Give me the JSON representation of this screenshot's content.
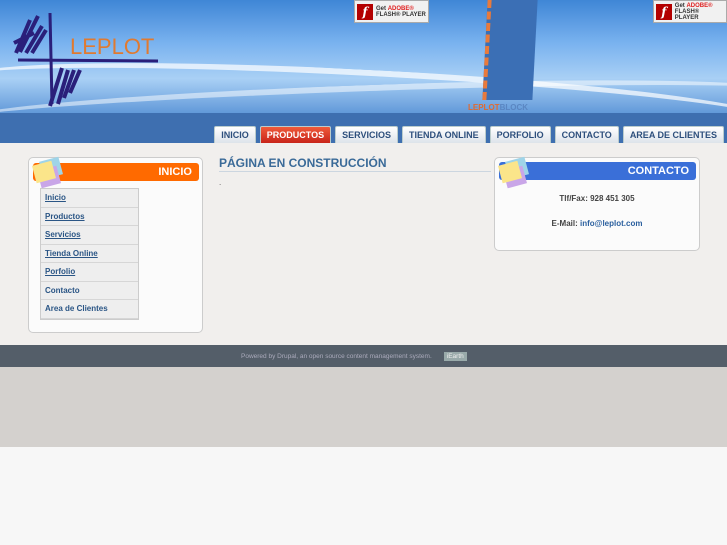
{
  "header": {
    "logo_text": "LEPLOT",
    "flash_badge": {
      "get": "Get",
      "adobe": "ADOBE®",
      "product": "FLASH® PLAYER"
    },
    "block_brand": [
      "LEPLOT",
      "BLOCK"
    ]
  },
  "nav": {
    "tabs": [
      {
        "label": "INICIO"
      },
      {
        "label": "PRODUCTOS",
        "active": true
      },
      {
        "label": "SERVICIOS"
      },
      {
        "label": "TIENDA ONLINE"
      },
      {
        "label": "PORFOLIO"
      },
      {
        "label": "CONTACTO"
      },
      {
        "label": "AREA DE CLIENTES"
      }
    ]
  },
  "sidebar": {
    "title": "INICIO",
    "items": [
      "Inicio",
      "Productos",
      "Servicios",
      "Tienda Online",
      "Porfolio",
      "Contacto",
      "Area de Clientes"
    ]
  },
  "main": {
    "title": "PÁGINA EN CONSTRUCCIÓN",
    "body": "."
  },
  "contact": {
    "title": "CONTACTO",
    "phone": "Tlf/Fax: 928 451 305",
    "email_label": "E-Mail:",
    "email": "info@leplot.com"
  },
  "footer": {
    "text": "Powered by Drupal, an open source content management system.",
    "badge": "iEarth"
  },
  "colors": {
    "orange": "#ff6a00",
    "blue": "#3a6fd8",
    "nav": "#3e6fb0",
    "active_tab": "#d9331f"
  }
}
